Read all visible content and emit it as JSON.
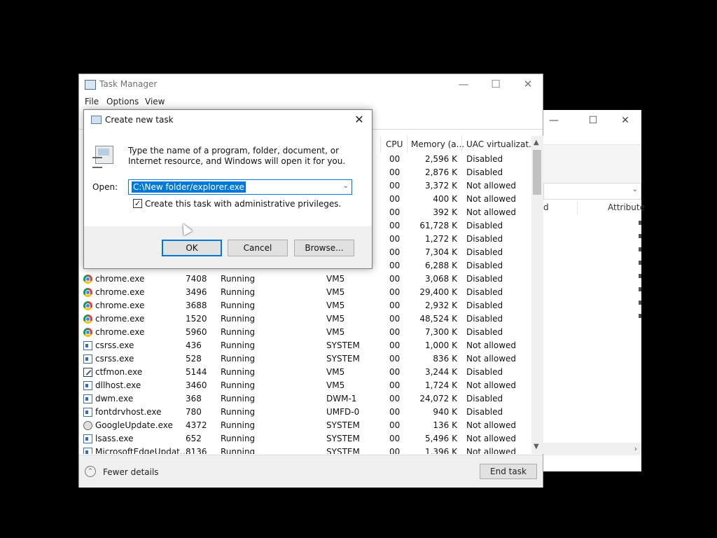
{
  "task_manager": {
    "title": "Task Manager",
    "menu": [
      "File",
      "Options",
      "View"
    ],
    "columns": {
      "cpu": "CPU",
      "memory": "Memory (a...",
      "uac": "UAC virtualizat..."
    },
    "top_rows": [
      {
        "cpu": "00",
        "memory": "2,596 K",
        "uac": "Disabled"
      },
      {
        "cpu": "00",
        "memory": "2,876 K",
        "uac": "Disabled"
      },
      {
        "cpu": "00",
        "memory": "3,372 K",
        "uac": "Not allowed"
      },
      {
        "cpu": "00",
        "memory": "400 K",
        "uac": "Not allowed"
      },
      {
        "cpu": "00",
        "memory": "392 K",
        "uac": "Not allowed"
      },
      {
        "cpu": "00",
        "memory": "61,728 K",
        "uac": "Disabled"
      },
      {
        "cpu": "00",
        "memory": "1,272 K",
        "uac": "Disabled"
      },
      {
        "cpu": "00",
        "memory": "7,304 K",
        "uac": "Disabled"
      },
      {
        "cpu": "00",
        "memory": "6,288 K",
        "uac": "Disabled"
      }
    ],
    "rows": [
      {
        "icon": "chrome",
        "name": "chrome.exe",
        "pid": "7408",
        "status": "Running",
        "user": "VM5",
        "cpu": "00",
        "memory": "3,068 K",
        "uac": "Disabled"
      },
      {
        "icon": "chrome",
        "name": "chrome.exe",
        "pid": "3496",
        "status": "Running",
        "user": "VM5",
        "cpu": "00",
        "memory": "29,400 K",
        "uac": "Disabled"
      },
      {
        "icon": "chrome",
        "name": "chrome.exe",
        "pid": "3688",
        "status": "Running",
        "user": "VM5",
        "cpu": "00",
        "memory": "2,932 K",
        "uac": "Disabled"
      },
      {
        "icon": "chrome",
        "name": "chrome.exe",
        "pid": "1520",
        "status": "Running",
        "user": "VM5",
        "cpu": "00",
        "memory": "48,524 K",
        "uac": "Disabled"
      },
      {
        "icon": "chrome",
        "name": "chrome.exe",
        "pid": "5960",
        "status": "Running",
        "user": "VM5",
        "cpu": "00",
        "memory": "7,300 K",
        "uac": "Disabled"
      },
      {
        "icon": "svc",
        "name": "csrss.exe",
        "pid": "436",
        "status": "Running",
        "user": "SYSTEM",
        "cpu": "00",
        "memory": "1,000 K",
        "uac": "Not allowed"
      },
      {
        "icon": "svc",
        "name": "csrss.exe",
        "pid": "528",
        "status": "Running",
        "user": "SYSTEM",
        "cpu": "00",
        "memory": "836 K",
        "uac": "Not allowed"
      },
      {
        "icon": "pen",
        "name": "ctfmon.exe",
        "pid": "5144",
        "status": "Running",
        "user": "VM5",
        "cpu": "00",
        "memory": "3,244 K",
        "uac": "Disabled"
      },
      {
        "icon": "svc",
        "name": "dllhost.exe",
        "pid": "3460",
        "status": "Running",
        "user": "VM5",
        "cpu": "00",
        "memory": "1,724 K",
        "uac": "Not allowed"
      },
      {
        "icon": "svc",
        "name": "dwm.exe",
        "pid": "368",
        "status": "Running",
        "user": "DWM-1",
        "cpu": "00",
        "memory": "24,072 K",
        "uac": "Disabled"
      },
      {
        "icon": "svc",
        "name": "fontdrvhost.exe",
        "pid": "780",
        "status": "Running",
        "user": "UMFD-0",
        "cpu": "00",
        "memory": "940 K",
        "uac": "Disabled"
      },
      {
        "icon": "gu",
        "name": "GoogleUpdate.exe",
        "pid": "4372",
        "status": "Running",
        "user": "SYSTEM",
        "cpu": "00",
        "memory": "136 K",
        "uac": "Not allowed"
      },
      {
        "icon": "svc",
        "name": "lsass.exe",
        "pid": "652",
        "status": "Running",
        "user": "SYSTEM",
        "cpu": "00",
        "memory": "5,496 K",
        "uac": "Not allowed"
      },
      {
        "icon": "svc",
        "name": "MicrosoftEdgeUpdat...",
        "pid": "8136",
        "status": "Running",
        "user": "SYSTEM",
        "cpu": "00",
        "memory": "1,396 K",
        "uac": "Not allowed"
      }
    ],
    "footer": {
      "fewer_details": "Fewer details",
      "end_task": "End task"
    }
  },
  "dialog": {
    "title": "Create new task",
    "description": "Type the name of a program, folder, document, or Internet resource, and Windows will open it for you.",
    "open_label": "Open:",
    "open_value": "C:\\New folder/explorer.exe",
    "checkbox_label": "Create this task with administrative privileges.",
    "checkbox_checked": true,
    "buttons": {
      "ok": "OK",
      "cancel": "Cancel",
      "browse": "Browse..."
    }
  },
  "background_window": {
    "column_fragment": "d",
    "attributes_header": "Attribute"
  },
  "colors": {
    "accent": "#0078d7",
    "chrome_bg": "#f0f0f0"
  }
}
